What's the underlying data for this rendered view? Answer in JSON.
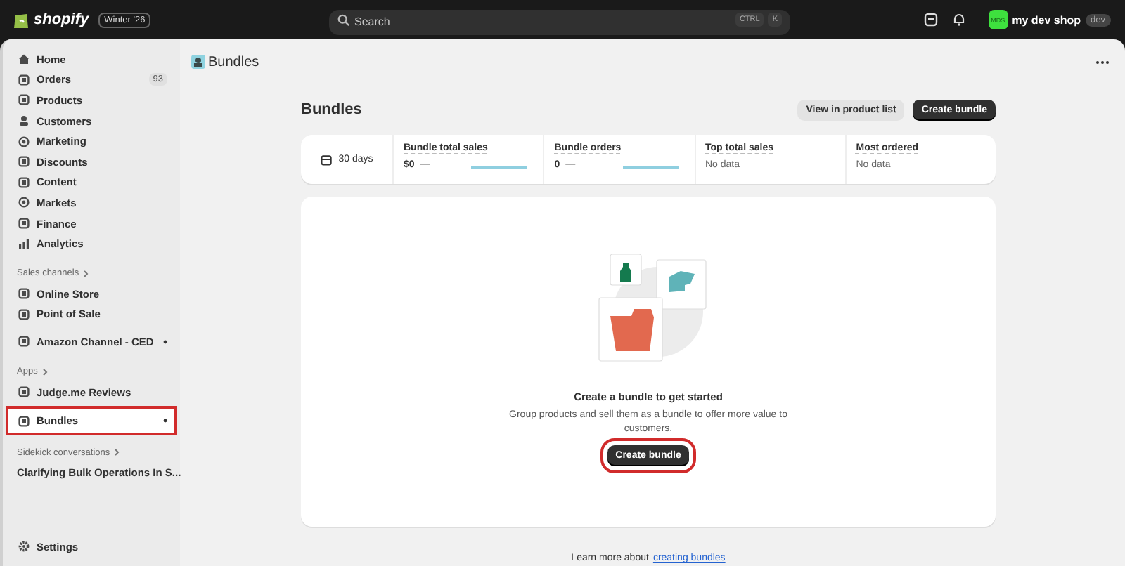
{
  "topbar": {
    "brand": "shopify",
    "release": "Winter '26",
    "search": {
      "placeholder": "Search",
      "keys": [
        "CTRL",
        "K"
      ]
    },
    "store": {
      "initials": "MDS",
      "name": "my dev shop",
      "tag": "dev"
    }
  },
  "sidebar": {
    "groups": [
      {
        "items": [
          {
            "label": "Home",
            "selected": false,
            "highlighted": false
          },
          {
            "label": "Orders",
            "badge": "93",
            "selected": false,
            "highlighted": false
          },
          {
            "label": "Products",
            "selected": false,
            "highlighted": false
          },
          {
            "label": "Customers",
            "selected": false,
            "highlighted": false
          },
          {
            "label": "Marketing",
            "selected": false,
            "highlighted": false
          },
          {
            "label": "Discounts",
            "selected": false,
            "highlighted": false
          },
          {
            "label": "Content",
            "selected": false,
            "highlighted": false
          },
          {
            "label": "Markets",
            "selected": false,
            "highlighted": false
          },
          {
            "label": "Finance",
            "selected": false,
            "highlighted": false
          },
          {
            "label": "Analytics",
            "selected": false,
            "highlighted": false
          }
        ]
      },
      {
        "heading": "Sales channels",
        "items": [
          {
            "label": "Online Store",
            "selected": false,
            "highlighted": false
          },
          {
            "label": "Point of Sale",
            "selected": false,
            "highlighted": false
          }
        ]
      },
      {
        "items": [
          {
            "label": "Amazon Channel - CED",
            "pinned": true,
            "selected": false,
            "highlighted": false
          }
        ]
      },
      {
        "heading": "Apps",
        "items": [
          {
            "label": "Judge.me Reviews",
            "selected": false,
            "highlighted": false
          }
        ]
      },
      {
        "items": [
          {
            "label": "Bundles",
            "pinned": true,
            "selected": true,
            "highlighted": true
          }
        ]
      },
      {
        "heading": "Sidekick conversations",
        "items": [
          {
            "label": "Clarifying Bulk Operations In S...",
            "selected": false,
            "highlighted": false
          }
        ]
      }
    ],
    "footer": {
      "label": "Settings"
    }
  },
  "page": {
    "app_title": "Bundles",
    "title": "Bundles",
    "actions": [
      {
        "label": "View in product list",
        "kind": "secondary"
      },
      {
        "label": "Create bundle",
        "kind": "primary"
      }
    ],
    "stats": {
      "period": "30 days",
      "metrics": [
        {
          "title": "Bundle total sales",
          "value": "$0",
          "trend": "—",
          "kind": "chart"
        },
        {
          "title": "Bundle orders",
          "value": "0",
          "trend": "—",
          "kind": "chart"
        },
        {
          "title": "Top total sales",
          "value": "No data",
          "kind": "text"
        },
        {
          "title": "Most ordered",
          "value": "No data",
          "kind": "text"
        }
      ]
    },
    "empty_state": {
      "heading": "Create a bundle to get started",
      "text": "Group products and sell them as a bundle to offer more value to customers.",
      "button": {
        "label": "Create bundle",
        "highlighted": true
      }
    },
    "footer": {
      "text": "Learn more about",
      "link": "creating bundles"
    }
  }
}
